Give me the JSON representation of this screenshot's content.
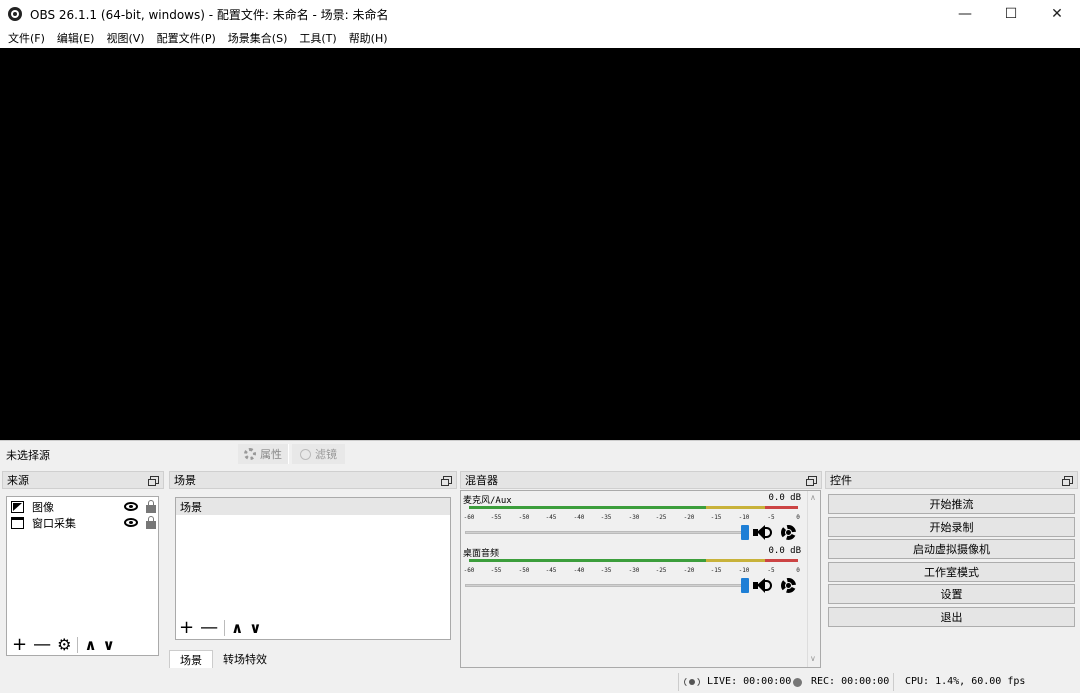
{
  "window": {
    "title": "OBS 26.1.1 (64-bit, windows) - 配置文件: 未命名 - 场景: 未命名",
    "minimize": "—",
    "maximize": "☐",
    "close": "✕"
  },
  "menu": [
    "文件(F)",
    "编辑(E)",
    "视图(V)",
    "配置文件(P)",
    "场景集合(S)",
    "工具(T)",
    "帮助(H)"
  ],
  "source_toolbar": {
    "no_source": "未选择源",
    "properties": "属性",
    "filters": "滤镜"
  },
  "sources_dock": {
    "title": "来源",
    "items": [
      {
        "label": "图像",
        "icon": "image-icon"
      },
      {
        "label": "窗口采集",
        "icon": "window-icon"
      }
    ],
    "tools": {
      "add": "+",
      "remove": "—",
      "settings": "⚙",
      "up": "∧",
      "down": "∨"
    }
  },
  "scenes_dock": {
    "title": "场景",
    "items": [
      "场景"
    ],
    "tools": {
      "add": "+",
      "remove": "—",
      "up": "∧",
      "down": "∨"
    },
    "tabs": [
      "场景",
      "转场特效"
    ]
  },
  "mixer_dock": {
    "title": "混音器",
    "ticks": [
      "-60",
      "-55",
      "-50",
      "-45",
      "-40",
      "-35",
      "-30",
      "-25",
      "-20",
      "-15",
      "-10",
      "-5",
      "0"
    ],
    "channels": [
      {
        "name": "麦克风/Aux",
        "level": "0.0 dB"
      },
      {
        "name": "桌面音频",
        "level": "0.0 dB"
      }
    ]
  },
  "controls_dock": {
    "title": "控件",
    "buttons": [
      "开始推流",
      "开始录制",
      "启动虚拟摄像机",
      "工作室模式",
      "设置",
      "退出"
    ]
  },
  "status": {
    "live": "LIVE: 00:00:00",
    "rec": "REC: 00:00:00",
    "cpu": "CPU: 1.4%, 60.00 fps"
  }
}
